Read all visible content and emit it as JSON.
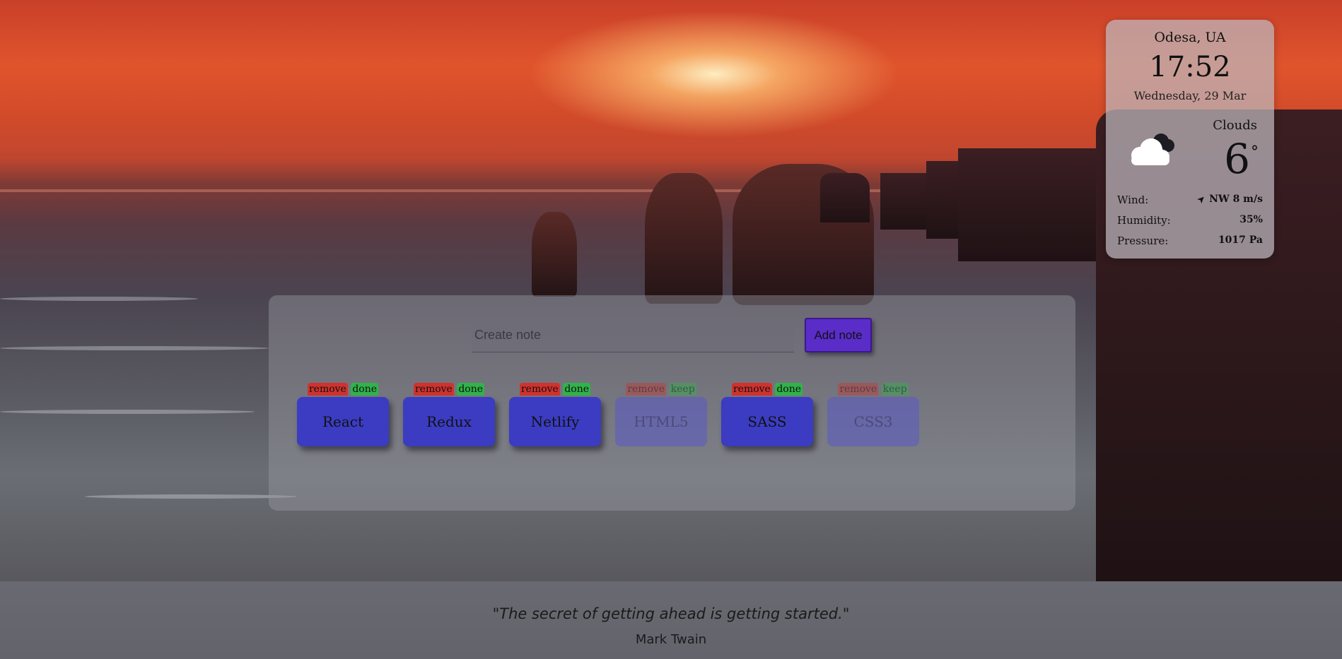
{
  "weather": {
    "city": "Odesa, UA",
    "time": "17:52",
    "date": "Wednesday, 29 Mar",
    "description": "Clouds",
    "temperature": "6",
    "degree_symbol": "°",
    "icon": "cloud-icon",
    "wind_label": "Wind:",
    "wind_value": "NW 8 m/s",
    "humidity_label": "Humidity:",
    "humidity_value": "35%",
    "pressure_label": "Pressure:",
    "pressure_value": "1017 Pa"
  },
  "notes_panel": {
    "input_placeholder": "Create note",
    "add_button_label": "Add note",
    "notes": [
      {
        "title": "React",
        "remove_label": "remove",
        "status_label": "done",
        "completed": false
      },
      {
        "title": "Redux",
        "remove_label": "remove",
        "status_label": "done",
        "completed": false
      },
      {
        "title": "Netlify",
        "remove_label": "remove",
        "status_label": "done",
        "completed": false
      },
      {
        "title": "HTML5",
        "remove_label": "remove",
        "status_label": "keep",
        "completed": true
      },
      {
        "title": "SASS",
        "remove_label": "remove",
        "status_label": "done",
        "completed": false
      },
      {
        "title": "CSS3",
        "remove_label": "remove",
        "status_label": "keep",
        "completed": true
      }
    ]
  },
  "quote": {
    "text": "\"The secret of getting ahead is getting started.\"",
    "author": "Mark Twain"
  }
}
